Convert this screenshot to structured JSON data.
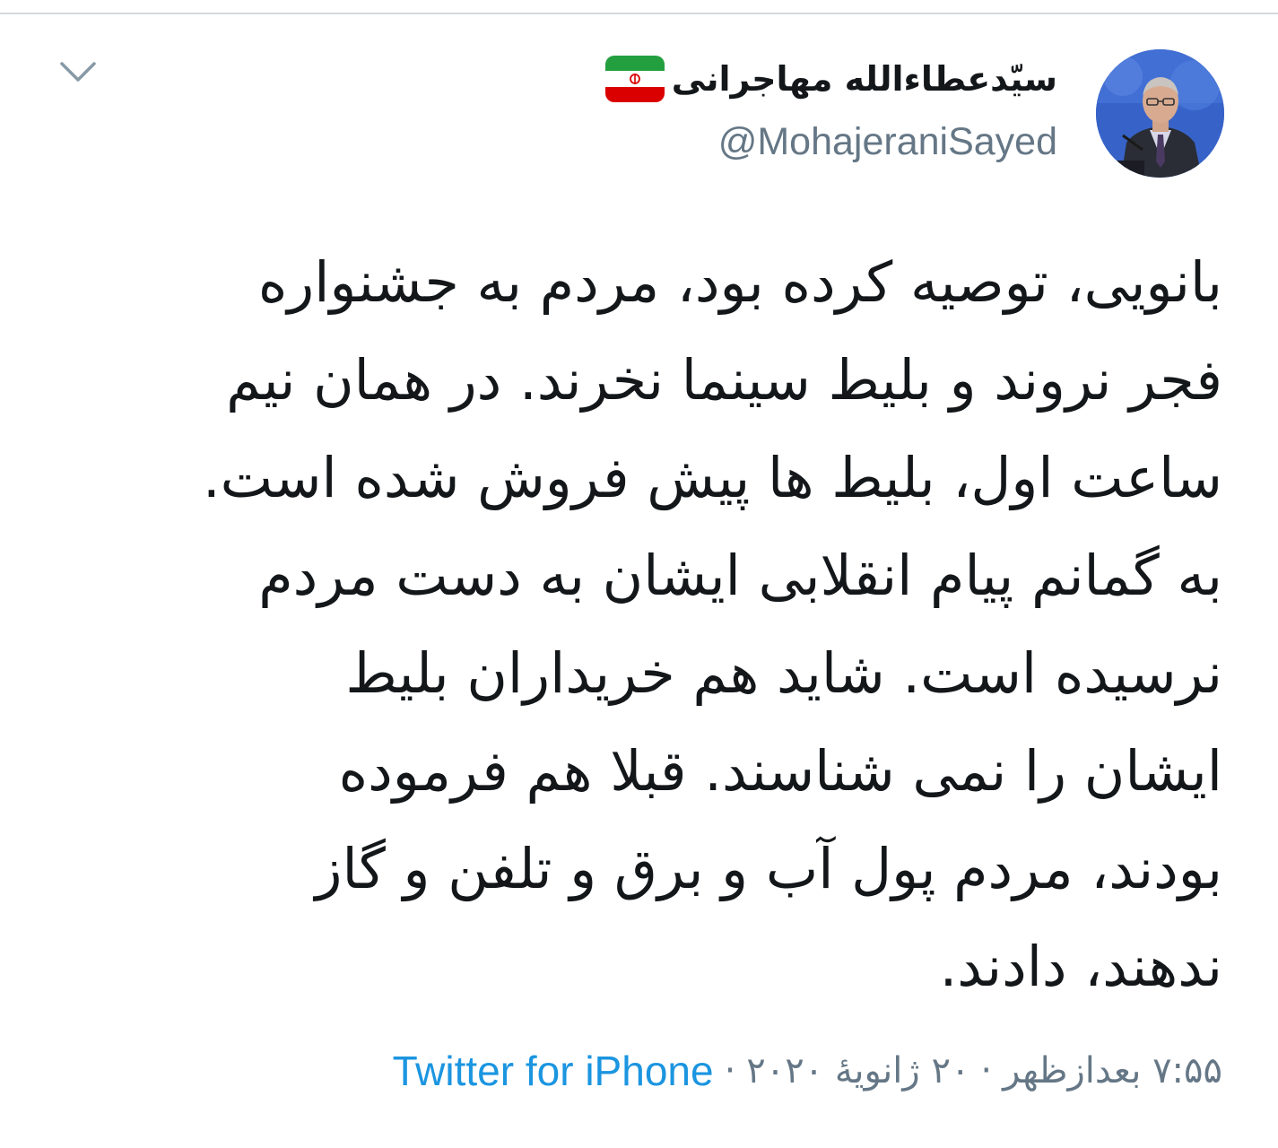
{
  "user": {
    "display_name": "سیّدعطاءالله مهاجرانی",
    "handle": "@MohajeraniSayed",
    "avatar_icon": "avatar-photo",
    "badge_icon": "iran-flag-icon"
  },
  "tweet": {
    "lines": [
      "بانویی، توصیه کرده بود، مردم به جشنواره",
      "فجر نروند و بلیط سینما نخرند. در همان نیم",
      "ساعت اول، بلیط ها پیش فروش شده است.",
      "به گمانم پیام انقلابی ایشان به دست مردم",
      "نرسیده است. شاید هم خریداران بلیط",
      "ایشان را نمی شناسند.  قبلا هم فرموده",
      "بودند، مردم پول آب و برق و تلفن و گاز",
      "ندهند، دادند."
    ]
  },
  "meta": {
    "time": "۷:۵۵ بعدازظهر",
    "date": "۲۰ ژانویهٔ ۲۰۲۰",
    "separator": "·",
    "source": "Twitter for iPhone"
  },
  "controls": {
    "menu_icon": "chevron-down-icon"
  },
  "colors": {
    "text_primary": "#14171a",
    "text_secondary": "#657786",
    "link": "#1b95e0",
    "divider": "#d4d9de"
  }
}
